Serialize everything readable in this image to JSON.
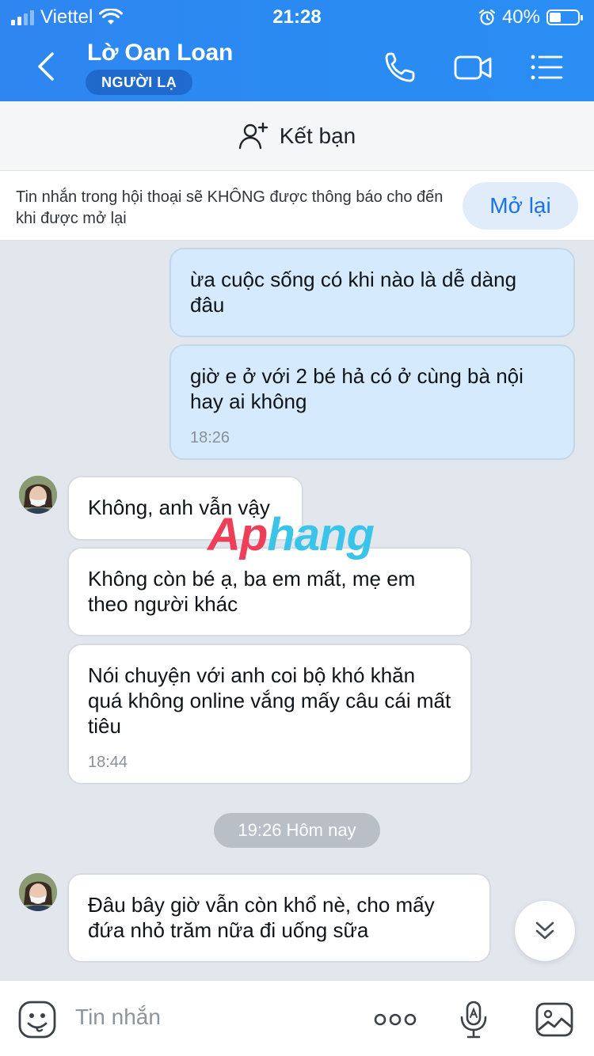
{
  "status_bar": {
    "carrier": "Viettel",
    "time": "21:28",
    "battery_text": "40%",
    "battery_level": 0.4
  },
  "header": {
    "contact_name": "Lờ Oan Loan",
    "badge": "NGƯỜI LẠ"
  },
  "friend_bar": {
    "label": "Kết bạn"
  },
  "notice": {
    "text": "Tin nhắn trong hội thoại sẽ KHÔNG được thông báo cho đến khi được mở lại",
    "button": "Mở lại"
  },
  "messages": [
    {
      "dir": "out",
      "text": "ừa cuộc sống có khi nào là dễ dàng đâu"
    },
    {
      "dir": "out",
      "text": "giờ e ở với 2 bé hả có ở cùng bà nội hay ai không",
      "time": "18:26"
    },
    {
      "dir": "in",
      "text": "Không, anh vẫn vậy"
    },
    {
      "dir": "in",
      "text": "Không còn bé ạ, ba em mất, mẹ em theo người khác"
    },
    {
      "dir": "in",
      "text": "Nói chuyện với anh coi bộ khó khăn quá không online vắng mấy câu cái mất tiêu",
      "time": "18:44"
    },
    {
      "dir": "in",
      "text": "Đâu bây giờ vẫn còn khổ nè, cho mấy đứa nhỏ trăm nữa đi uống sữa"
    }
  ],
  "date_separator": "19:26 Hôm nay",
  "watermark": {
    "part1": "Ap",
    "part2": "hang"
  },
  "input": {
    "placeholder": "Tin nhắn"
  },
  "colors": {
    "header": "#2f86f0",
    "outgoing_bubble": "#d5eafd",
    "incoming_bubble": "#ffffff",
    "background": "#e2e7ee",
    "accent": "#1a73e8"
  }
}
